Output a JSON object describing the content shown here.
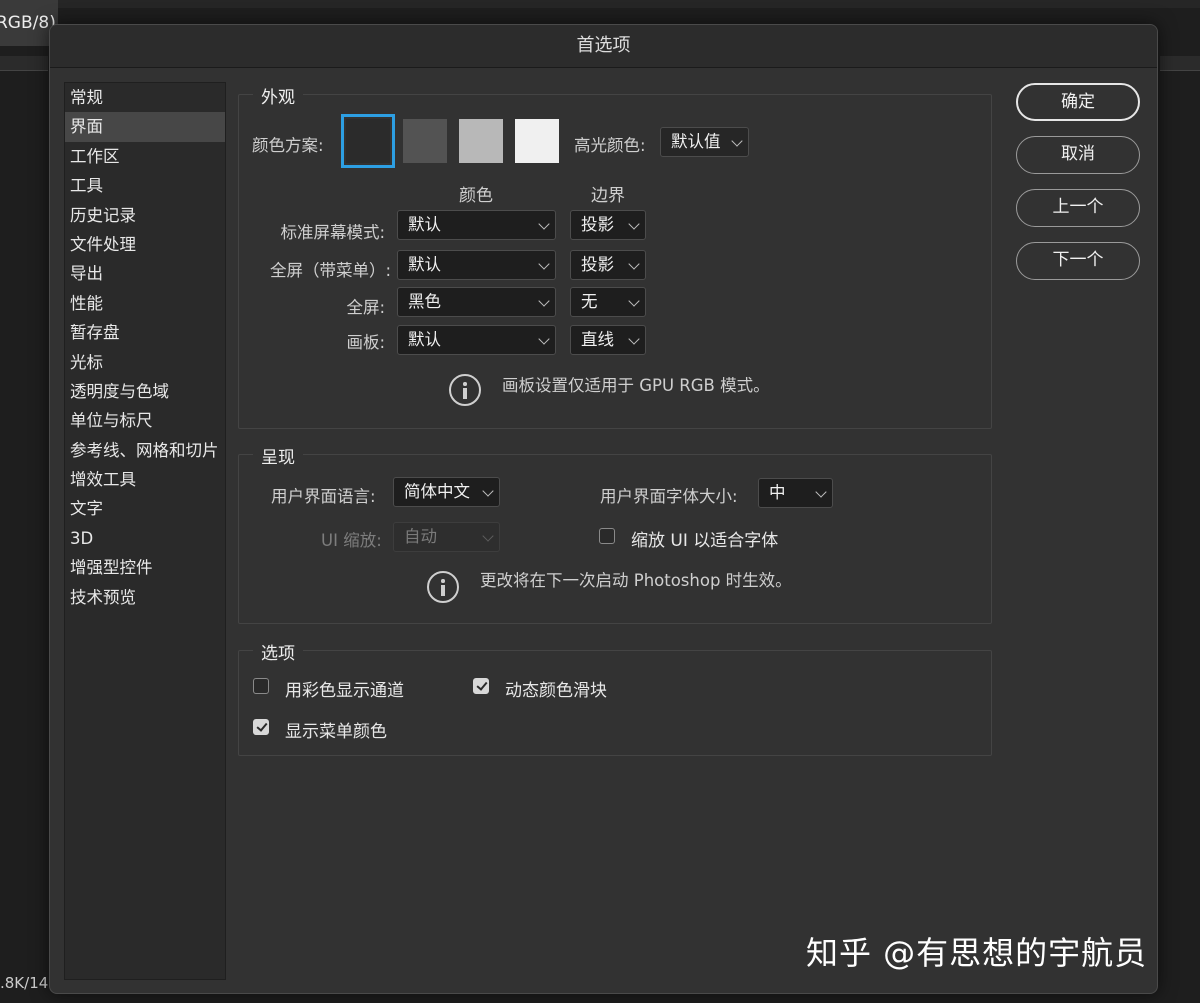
{
  "background": {
    "tab_fragment": "RGB/8)",
    "status_fragment": ".8K/14"
  },
  "dialog": {
    "title": "首选项"
  },
  "sidebar": {
    "items": [
      {
        "label": "常规"
      },
      {
        "label": "界面",
        "selected": true
      },
      {
        "label": "工作区"
      },
      {
        "label": "工具"
      },
      {
        "label": "历史记录"
      },
      {
        "label": "文件处理"
      },
      {
        "label": "导出"
      },
      {
        "label": "性能"
      },
      {
        "label": "暂存盘"
      },
      {
        "label": "光标"
      },
      {
        "label": "透明度与色域"
      },
      {
        "label": "单位与标尺"
      },
      {
        "label": "参考线、网格和切片"
      },
      {
        "label": "增效工具"
      },
      {
        "label": "文字"
      },
      {
        "label": "3D"
      },
      {
        "label": "增强型控件"
      },
      {
        "label": "技术预览"
      }
    ]
  },
  "appearance": {
    "title": "外观",
    "color_scheme_label": "颜色方案:",
    "swatch_colors": [
      "#2b2b2b",
      "#535353",
      "#b8b8b8",
      "#f0f0f0"
    ],
    "selected_swatch": 0,
    "highlight_label": "高光颜色:",
    "highlight_value": "默认值",
    "col_color": "颜色",
    "col_border": "边界",
    "rows": [
      {
        "label": "标准屏幕模式:",
        "color": "默认",
        "border": "投影"
      },
      {
        "label": "全屏（带菜单）:",
        "color": "默认",
        "border": "投影"
      },
      {
        "label": "全屏:",
        "color": "黑色",
        "border": "无"
      },
      {
        "label": "画板:",
        "color": "默认",
        "border": "直线"
      }
    ],
    "note": "画板设置仅适用于 GPU RGB 模式。"
  },
  "presentation": {
    "title": "呈现",
    "language_label": "用户界面语言:",
    "language_value": "简体中文",
    "font_size_label": "用户界面字体大小:",
    "font_size_value": "中",
    "ui_scale_label": "UI 缩放:",
    "ui_scale_value": "自动",
    "scale_to_font_label": "缩放 UI 以适合字体",
    "scale_to_font_checked": false,
    "note": "更改将在下一次启动 Photoshop 时生效。"
  },
  "options": {
    "title": "选项",
    "color_channels_label": "用彩色显示通道",
    "color_channels_checked": false,
    "dynamic_sliders_label": "动态颜色滑块",
    "dynamic_sliders_checked": true,
    "menu_colors_label": "显示菜单颜色",
    "menu_colors_checked": true
  },
  "buttons": {
    "ok": "确定",
    "cancel": "取消",
    "prev": "上一个",
    "next": "下一个"
  },
  "watermark": "知乎 @有思想的宇航员"
}
